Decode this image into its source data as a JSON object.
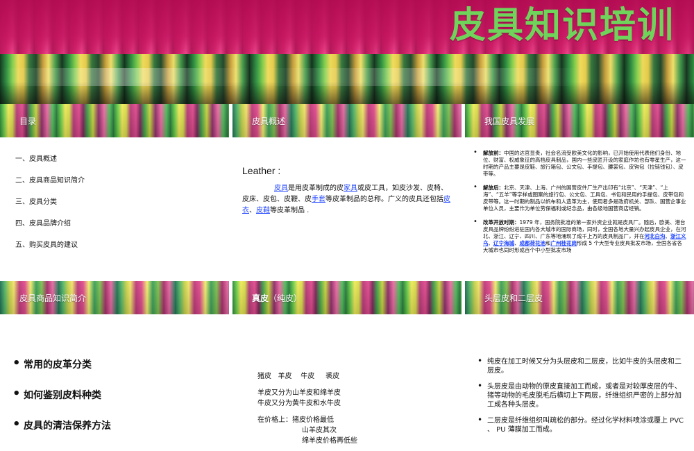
{
  "banner": {
    "title": "皮具知识培训"
  },
  "panels": {
    "p1": {
      "header": "目录",
      "items": [
        "一、皮具概述",
        "二、皮具商品知识简介",
        "三、皮具分类",
        "四、皮具品牌介绍",
        "五、购买皮具的建议"
      ]
    },
    "p2": {
      "header": "皮具概述",
      "leather_title": "Leather :",
      "text": {
        "a": "皮具",
        "b": "是用皮革制成的皮",
        "c": "家具",
        "d": "或皮工具，如皮沙发、皮椅、皮床、皮包、皮鞭、皮",
        "e": "手套",
        "f": "等皮革制品的总称。广义的皮具还包括",
        "g": "皮衣",
        "h": "、",
        "i": "皮鞋",
        "j": "等皮革制品 ."
      }
    },
    "p3": {
      "header": "我国皮具发展",
      "items": [
        {
          "label": "解放前：",
          "text": "中国的达官显贵，社会名流受欧美文化的影响，已开始使用代表他们身份、地位、财富、权威象征的高档皮具制品，国内一些皮匠开设的家庭作坊也有零星生产，这一时期的产品主要是皮鞋、旅行箱包、公文包、手提包、腰裳包、皮钩包（拉链钱包）、皮带等。"
        },
        {
          "label": "解放后：",
          "text": "北京、天津、上海、广州的国营皮件厂生产出印有“北京”、“天津”、“上海”、“五羊”等字样或图案的旅行包、公文包、工具包、书包和民用的手提包、皮带包和皮带等。这一时期的制品以帆布和人造革为主，使用者多是政府机关、部队、国营企事业单位人员，主要作为单位劳保福利或纪念品，由各级地国营商店经销。"
        },
        {
          "label": "改革开放时期：",
          "text1": "1979 年，国务院批准的第一家外资企业就是皮具厂。随后，欧美、港台皮具品牌纷纷进驻国内各大城市的国际商场，同时，全国各地大量兴办起皮具企业，在河北、浙江、辽宁、四川、广东等地涌现了成千上万的皮具制品厂，并在",
          "link1": "河北白沟",
          "sep1": "、",
          "link2": "浙江义乌",
          "sep2": "、",
          "link3": "辽宁海城",
          "sep3": "、",
          "link4": "成都荷花池",
          "sep4": "和",
          "link5": "广州桂花",
          "link6": "岗",
          "text2": "形成 5 个大型专业皮具批发市场，全国各省各大城市也同时形成百个中小型批发市场"
        }
      ]
    },
    "p4": {
      "header": "皮具商品知识简介",
      "items": [
        "常用的皮革分类",
        "如何鉴别皮料种类",
        "皮具的清洁保养方法"
      ]
    },
    "p5": {
      "header_bold": "真皮",
      "header_rest": "（纯皮）",
      "lines": {
        "l1": "猪皮   羊皮    牛皮     裘皮",
        "l2": "羊皮又分为山羊皮和绵羊皮",
        "l3": "牛皮又分为黄牛皮和水牛皮",
        "l4a": "在价格上：",
        "l4b": "猪皮价格最低",
        "l5": "山羊皮其次",
        "l6": "绵羊皮价格再低些"
      }
    },
    "p6": {
      "header": "头层皮和二层皮",
      "items": [
        "纯皮在加工时候又分为头层皮和二层皮，比如牛皮的头层皮和二层皮。",
        "头层皮是由动物的原皮直接加工而成，或者是对较厚皮层的牛、猪等动物的毛皮脱毛后横切上下两层，纤维组织严密的上部分加工成各种头层皮。",
        "二层皮是纤维组织叫疏松的部分。经过化学材料喷涂或覆上 PVC 、    PU 薄膜加工而成。"
      ]
    }
  }
}
